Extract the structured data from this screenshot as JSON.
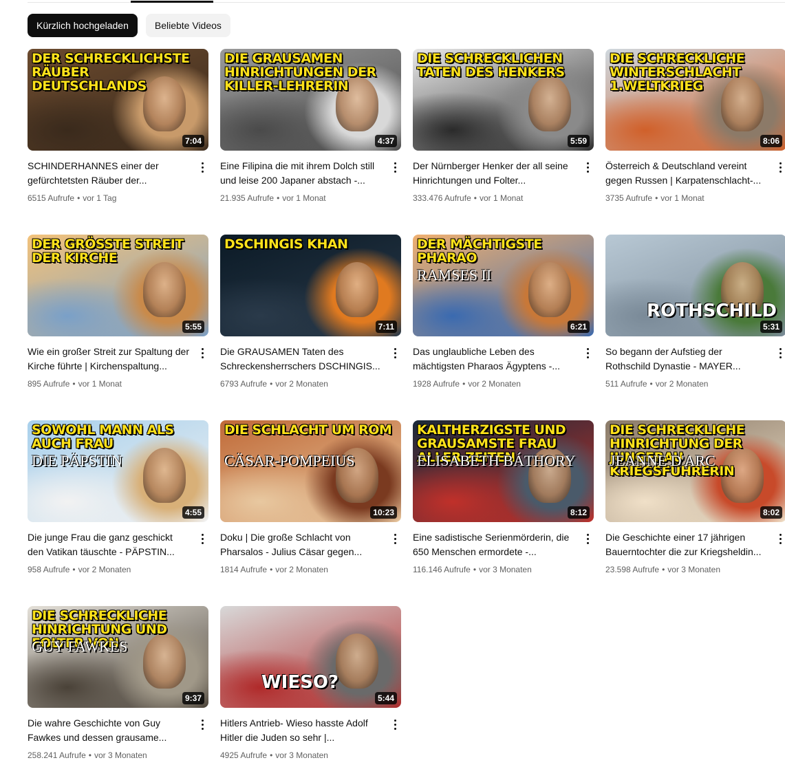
{
  "chips": [
    {
      "label": "Kürzlich hochgeladen",
      "active": true
    },
    {
      "label": "Beliebte Videos",
      "active": false
    }
  ],
  "videos": [
    {
      "thumb_text": "Der schrecklichste Räuber Deutschlands",
      "thumb_sub": "",
      "duration": "7:04",
      "title": "SCHINDERHANNES einer der gefürchtetsten Räuber der...",
      "views": "6515 Aufrufe",
      "age": "vor 1 Tag",
      "colors": [
        "#6b4a2e",
        "#c89a6a",
        "#3a2a1c"
      ]
    },
    {
      "thumb_text": "Die grausamen Hinrichtungen der Killer-Lehrerin",
      "thumb_sub": "",
      "duration": "4:37",
      "title": "Eine Filipina die mit ihrem Dolch still und leise 200 Japaner abstach -...",
      "views": "21.935 Aufrufe",
      "age": "vor 1 Monat",
      "colors": [
        "#9a9a9a",
        "#d8d8d8",
        "#4a4a4a"
      ]
    },
    {
      "thumb_text": "Die schrecklichen Taten des Henkers",
      "thumb_sub": "",
      "duration": "5:59",
      "title": "Der Nürnberger Henker der all seine Hinrichtungen und Folter...",
      "views": "333.476 Aufrufe",
      "age": "vor 1 Monat",
      "colors": [
        "#e8e8e8",
        "#8a8a8a",
        "#2a2a2a"
      ]
    },
    {
      "thumb_text": "Die schreckliche Winterschlacht 1.Weltkrieg",
      "thumb_sub": "",
      "duration": "8:06",
      "title": "Österreich & Deutschland vereint gegen Russen | Karpatenschlacht-...",
      "views": "3735 Aufrufe",
      "age": "vor 1 Monat",
      "colors": [
        "#cfd8de",
        "#8c7a68",
        "#d0602a"
      ]
    },
    {
      "thumb_text": "Der größte Streit der Kirche",
      "thumb_sub": "",
      "duration": "5:55",
      "title": "Wie ein großer Streit zur Spaltung der Kirche führte | Kirchenspaltung...",
      "views": "895 Aufrufe",
      "age": "vor 1 Monat",
      "colors": [
        "#f3c27a",
        "#c98a4a",
        "#7aa0c8"
      ]
    },
    {
      "thumb_text": "Dschingis Khan",
      "thumb_sub": "",
      "duration": "7:11",
      "title": "Die GRAUSAMEN Taten des Schreckensherrschers DSCHINGIS...",
      "views": "6793 Aufrufe",
      "age": "vor 2 Monaten",
      "colors": [
        "#0b1a26",
        "#e07a20",
        "#2a3a4a"
      ]
    },
    {
      "thumb_text": "Der mächtigste Pharao",
      "thumb_sub": "RAMSES II",
      "duration": "6:21",
      "title": "Das unglaubliche Leben des mächtigsten Pharaos Ägyptens -...",
      "views": "1928 Aufrufe",
      "age": "vor 2 Monaten",
      "colors": [
        "#f0b070",
        "#c87838",
        "#3a6ab0"
      ]
    },
    {
      "thumb_text": "",
      "thumb_sub": "ROTHSCHILD",
      "duration": "5:31",
      "title": "So begann der Aufstieg der Rothschild Dynastie - MAYER...",
      "views": "511 Aufrufe",
      "age": "vor 2 Monaten",
      "colors": [
        "#b8c8d4",
        "#4a7a3a",
        "#7a8a98"
      ]
    },
    {
      "thumb_text": "Sowohl Mann als auch Frau",
      "thumb_sub": "DIE PÄPSTIN",
      "duration": "4:55",
      "title": "Die junge Frau die ganz geschickt den Vatikan täuschte - PÄPSTIN...",
      "views": "958 Aufrufe",
      "age": "vor 2 Monaten",
      "colors": [
        "#a8d0ec",
        "#d8b078",
        "#f2f2f2"
      ]
    },
    {
      "thumb_text": "Die Schlacht um Rom",
      "thumb_sub": "CÄSAR-POMPEIUS",
      "duration": "10:23",
      "title": "Doku | Die große Schlacht von Pharsalos - Julius Cäsar gegen...",
      "views": "1814 Aufrufe",
      "age": "vor 2 Monaten",
      "colors": [
        "#c06a38",
        "#7a3a20",
        "#e8c8a0"
      ]
    },
    {
      "thumb_text": "Kaltherzigste und grausamste Frau aller Zeiten",
      "thumb_sub": "ELISABETH BÁTHORY",
      "duration": "8:12",
      "title": "Eine sadistische Serienmörderin, die 650 Menschen ermordete -...",
      "views": "116.146 Aufrufe",
      "age": "vor 3 Monaten",
      "colors": [
        "#1a2a3a",
        "#4a5a6a",
        "#c0302a"
      ]
    },
    {
      "thumb_text": "Die schreckliche Hinrichtung der Jungfrau Kriegsführerin",
      "thumb_sub": "JEANNE D'ARC",
      "duration": "8:02",
      "title": "Die Geschichte einer 17 jährigen Bauerntochter die zur Kriegsheldin...",
      "views": "23.598 Aufrufe",
      "age": "vor 3 Monaten",
      "colors": [
        "#8a7a68",
        "#c84a2a",
        "#f0e0c8"
      ]
    },
    {
      "thumb_text": "Die schreckliche Hinrichtung und Folter von",
      "thumb_sub": "GUY FAWKES",
      "duration": "9:37",
      "title": "Die wahre Geschichte von Guy Fawkes und dessen grausame...",
      "views": "258.241 Aufrufe",
      "age": "vor 3 Monaten",
      "colors": [
        "#e4e0d8",
        "#a09888",
        "#4a4238"
      ]
    },
    {
      "thumb_text": "",
      "thumb_sub": "WIESO?",
      "duration": "5:44",
      "title": "Hitlers Antrieb- Wieso hasste Adolf Hitler die Juden so sehr |...",
      "views": "4925 Aufrufe",
      "age": "vor 3 Monaten",
      "colors": [
        "#d8d8d8",
        "#6a6a6a",
        "#b02a2a"
      ]
    }
  ],
  "meta_separator": "•"
}
